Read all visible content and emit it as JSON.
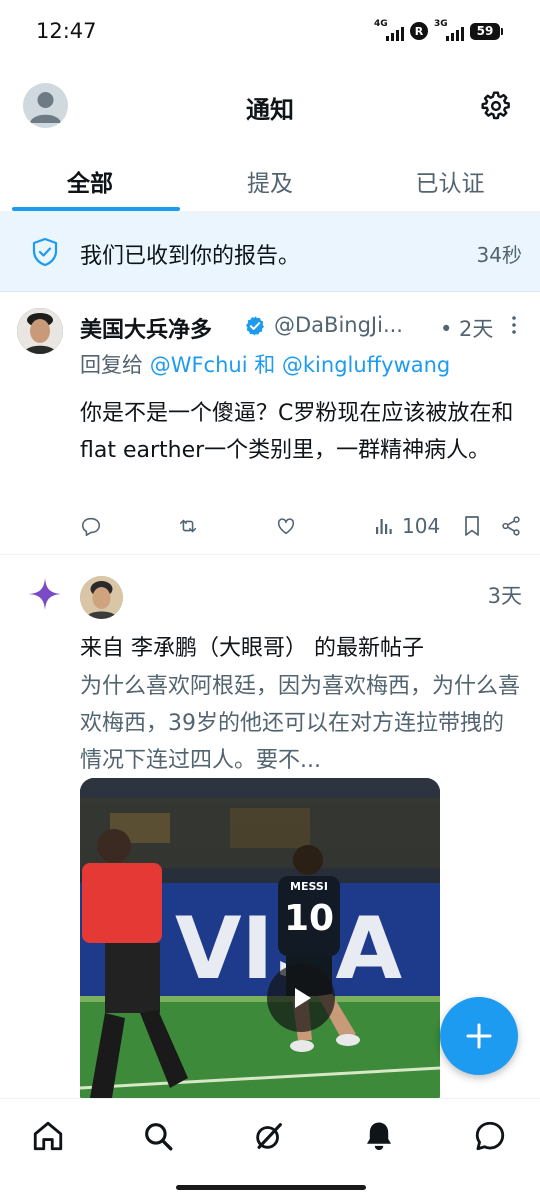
{
  "status_bar": {
    "time": "12:47",
    "net1": "4G",
    "net2": "3G",
    "r_badge": "R",
    "battery": "59"
  },
  "header": {
    "title": "通知",
    "avatar_icon": "default-avatar-icon",
    "settings_icon": "gear-icon"
  },
  "tabs": [
    {
      "label": "全部",
      "active": true
    },
    {
      "label": "提及",
      "active": false
    },
    {
      "label": "已认证",
      "active": false
    }
  ],
  "banner": {
    "icon": "shield-check-icon",
    "text": "我们已收到你的报告。",
    "time": "34秒"
  },
  "notification_1": {
    "name": "美国大兵净多",
    "handle": "@DaBingJi...",
    "time": "• 2天",
    "reply_prefix": "回复给 ",
    "mention_1": "@WFchui",
    "reply_and": " 和 ",
    "mention_2": "@kingluffywang",
    "body": "你是不是一个傻逼？C罗粉现在应该被放在和flat earther一个类别里，一群精神病人。",
    "views": "104",
    "icons": [
      "reply-icon",
      "retweet-icon",
      "like-icon",
      "views-icon",
      "bookmark-icon",
      "share-icon"
    ]
  },
  "notification_2": {
    "icon": "sparkle-icon",
    "time": "3天",
    "title": "来自 李承鹏（大眼哥） 的最新帖子",
    "body": "为什么喜欢阿根廷，因为喜欢梅西，为什么喜欢梅西，39岁的他还可以在对方连拉带拽的情况下连过四人。要不...",
    "media_jersey_name": "MESSI",
    "media_jersey_number": "10",
    "media_board_text": "VISA"
  },
  "fab": {
    "icon": "plus-icon"
  },
  "bottom_nav": [
    {
      "icon": "home-icon"
    },
    {
      "icon": "search-icon"
    },
    {
      "icon": "grok-icon"
    },
    {
      "icon": "notifications-bell-icon",
      "active": true
    },
    {
      "icon": "messages-icon"
    }
  ],
  "colors": {
    "accent": "#1d9bf0",
    "banner_bg": "#eaf5fd",
    "secondary_text": "#536471",
    "sparkle": "#794bc4"
  }
}
